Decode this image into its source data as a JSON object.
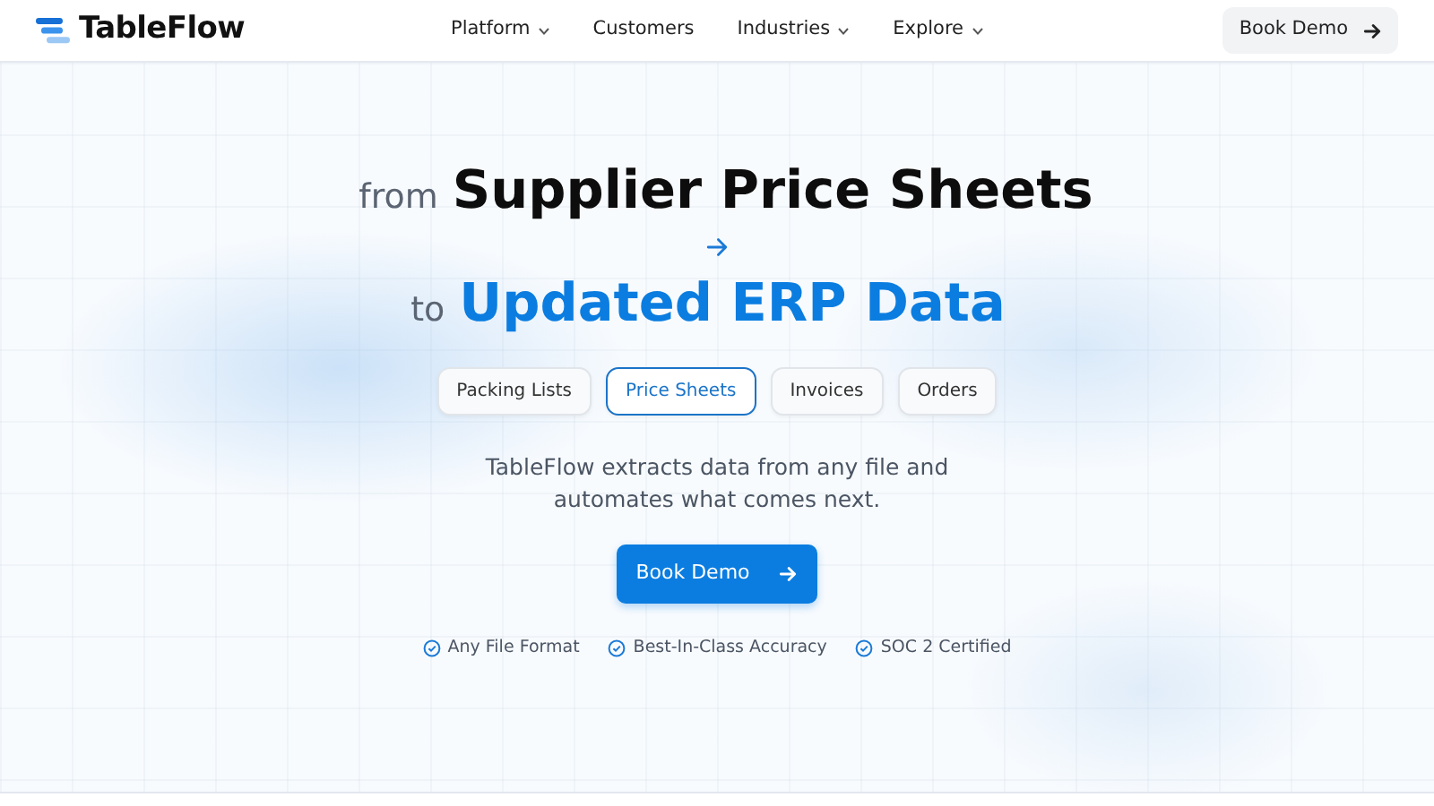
{
  "brand": {
    "name": "TableFlow"
  },
  "nav": [
    {
      "label": "Platform",
      "has_menu": true
    },
    {
      "label": "Customers",
      "has_menu": false
    },
    {
      "label": "Industries",
      "has_menu": true
    },
    {
      "label": "Explore",
      "has_menu": true
    }
  ],
  "header_button": {
    "label": "Book Demo"
  },
  "headline": {
    "from_prefix": "from",
    "from_text": "Supplier Price Sheets",
    "to_prefix": "to",
    "to_text": "Updated ERP Data"
  },
  "doc_tabs": [
    {
      "label": "Packing Lists",
      "selected": false
    },
    {
      "label": "Price Sheets",
      "selected": true
    },
    {
      "label": "Invoices",
      "selected": false
    },
    {
      "label": "Orders",
      "selected": false
    }
  ],
  "description": "TableFlow extracts data from any file and automates what comes next.",
  "cta": {
    "label": "Book Demo"
  },
  "features": [
    "Any File Format",
    "Best-In-Class Accuracy",
    "SOC 2 Certified"
  ]
}
